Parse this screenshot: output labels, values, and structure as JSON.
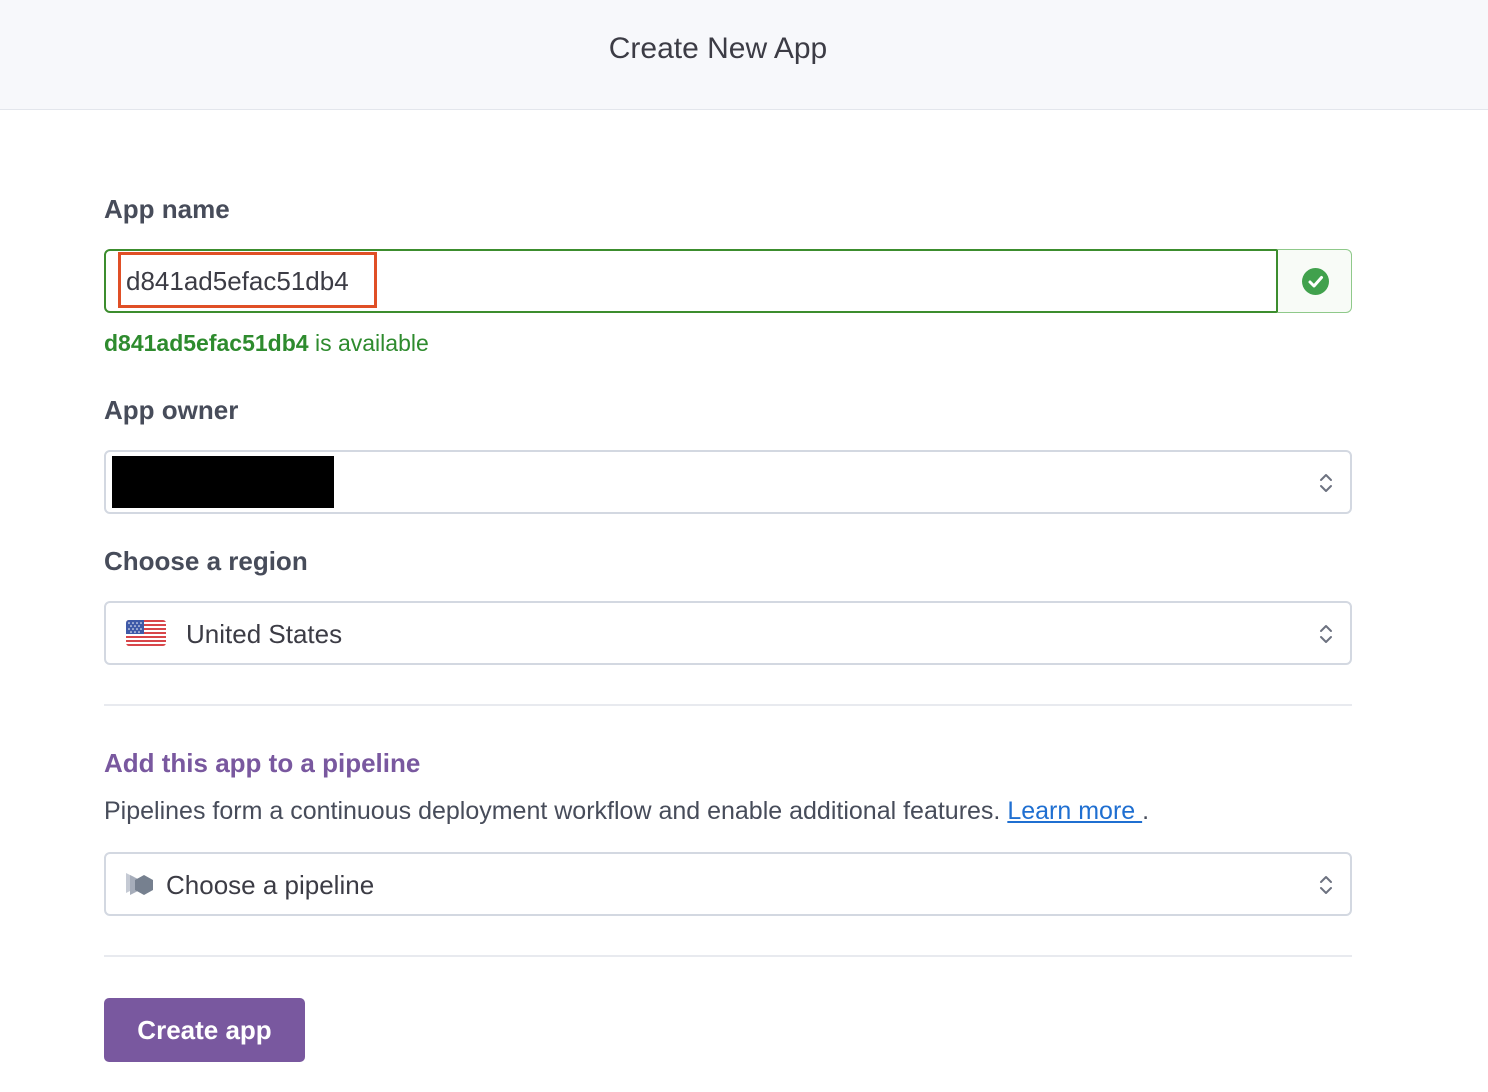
{
  "header": {
    "title": "Create New App"
  },
  "app_name": {
    "label": "App name",
    "value": "d841ad5efac51db4",
    "status_icon": "check-circle-icon",
    "availability_name": "d841ad5efac51db4",
    "availability_suffix": " is available"
  },
  "app_owner": {
    "label": "App owner",
    "value_redacted": true,
    "icon": "chevron-up-down-icon"
  },
  "region": {
    "label": "Choose a region",
    "selected": "United States",
    "flag_icon": "us-flag-icon",
    "icon": "chevron-up-down-icon"
  },
  "pipeline": {
    "title": "Add this app to a pipeline",
    "description": "Pipelines form a continuous deployment workflow and enable additional features.",
    "learn_more": "Learn more ",
    "trailing": ".",
    "placeholder": "Choose a pipeline",
    "icon": "pipeline-icon"
  },
  "actions": {
    "create_label": "Create app"
  },
  "colors": {
    "accent_purple": "#79589f",
    "success_green": "#3c8d2e",
    "highlight_orange": "#e04f26",
    "link_blue": "#1f6fd1"
  }
}
